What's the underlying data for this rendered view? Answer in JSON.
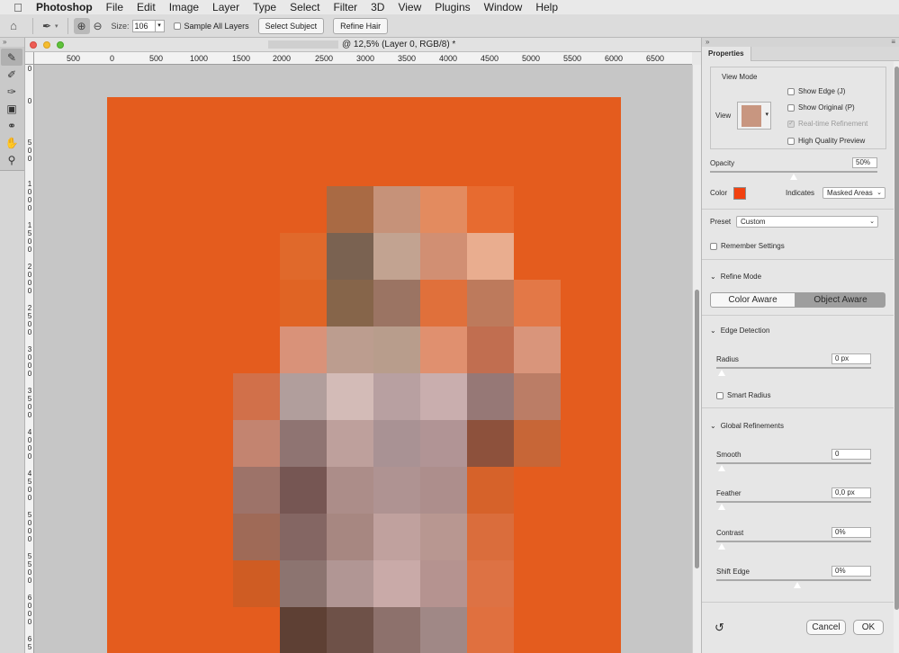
{
  "menubar": {
    "apple_icon": "apple-icon",
    "items": [
      "Photoshop",
      "File",
      "Edit",
      "Image",
      "Layer",
      "Type",
      "Select",
      "Filter",
      "3D",
      "View",
      "Plugins",
      "Window",
      "Help"
    ]
  },
  "options_bar": {
    "home_icon": "home-icon",
    "size_label": "Size:",
    "size_value": "106",
    "sample_all_layers_label": "Sample All Layers",
    "sample_all_layers_checked": false,
    "select_subject_label": "Select Subject",
    "refine_hair_label": "Refine Hair"
  },
  "tools": [
    "refine-edge-brush-icon",
    "brush-icon",
    "quick-selection-icon",
    "object-selection-icon",
    "lasso-icon",
    "hand-icon",
    "zoom-icon"
  ],
  "document": {
    "title": "@ 12,5% (Layer 0, RGB/8) *",
    "ruler_h_labels": [
      "500",
      "0",
      "500",
      "1000",
      "1500",
      "2000",
      "2500",
      "3000",
      "3500",
      "4000",
      "4500",
      "5000",
      "5500",
      "6000",
      "6500"
    ],
    "ruler_v_labels": [
      "0",
      "0",
      "5\n0\n0",
      "1\n0\n0\n0",
      "1\n5\n0\n0",
      "2\n0\n0\n0",
      "2\n5\n0\n0",
      "3\n0\n0\n0",
      "3\n5\n0\n0",
      "4\n0\n0\n0",
      "4\n5\n0\n0",
      "5\n0\n0\n0",
      "5\n5\n0\n0",
      "6\n0\n0\n0",
      "6\n5"
    ],
    "background_color": "#e45c1e",
    "pixel_rows": [
      [
        "",
        "",
        "",
        "#a96a44",
        "#c69279",
        "#e38b5f",
        "#e76b30",
        ""
      ],
      [
        "",
        "",
        "#e0692b",
        "#7a6251",
        "#c2a391",
        "#d18f73",
        "#e9ad8f",
        ""
      ],
      [
        "",
        "",
        "#e06424",
        "#86654a",
        "#9b7463",
        "#e0703b",
        "#bd7a5c",
        "#e37847"
      ],
      [
        "",
        "",
        "#d99279",
        "#bc9d8f",
        "#b89d8c",
        "#e0906f",
        "#c16e50",
        "#d9957b"
      ],
      [
        "",
        "#d1704a",
        "#b19e9c",
        "#d3bbb7",
        "#b8a0a1",
        "#c9aeae",
        "#967876",
        "#bb7d66"
      ],
      [
        "",
        "#c38470",
        "#8f7472",
        "#bea09c",
        "#a99294",
        "#b19495",
        "#8d513c",
        "#c76637"
      ],
      [
        "",
        "#9d7369",
        "#765653",
        "#ac8d89",
        "#af9392",
        "#ad8e8c",
        "#d6622a",
        ""
      ],
      [
        "",
        "#9f6a57",
        "#846663",
        "#a78781",
        "#c0a19e",
        "#b89791",
        "#da6d3c",
        ""
      ],
      [
        "",
        "#cf5c23",
        "#8c7470",
        "#b19694",
        "#c9aaa8",
        "#b59390",
        "#dd7244",
        ""
      ],
      [
        "",
        "",
        "#5e4034",
        "#6e5148",
        "#8d716c",
        "#a08886",
        "#e0703f",
        ""
      ]
    ]
  },
  "properties": {
    "panel_tab": "Properties",
    "view_mode_title": "View Mode",
    "view_label": "View",
    "show_edge": "Show Edge (J)",
    "show_original": "Show Original (P)",
    "realtime_refinement": "Real-time Refinement",
    "high_quality_preview": "High Quality Preview",
    "opacity_label": "Opacity",
    "opacity_value": "50%",
    "opacity_level": 0.5,
    "color_label": "Color",
    "color_swatch": "#f2410f",
    "indicates_label": "Indicates",
    "indicates_value": "Masked Areas",
    "preset_label": "Preset",
    "preset_value": "Custom",
    "remember_settings": "Remember Settings",
    "refine_mode_title": "Refine Mode",
    "color_aware": "Color Aware",
    "object_aware": "Object Aware",
    "edge_detection_title": "Edge Detection",
    "radius_label": "Radius",
    "radius_value": "0 px",
    "smart_radius": "Smart Radius",
    "global_refinements_title": "Global Refinements",
    "smooth_label": "Smooth",
    "smooth_value": "0",
    "feather_label": "Feather",
    "feather_value": "0,0 px",
    "contrast_label": "Contrast",
    "contrast_value": "0%",
    "shift_edge_label": "Shift Edge",
    "shift_edge_value": "0%",
    "cancel": "Cancel",
    "ok": "OK"
  }
}
